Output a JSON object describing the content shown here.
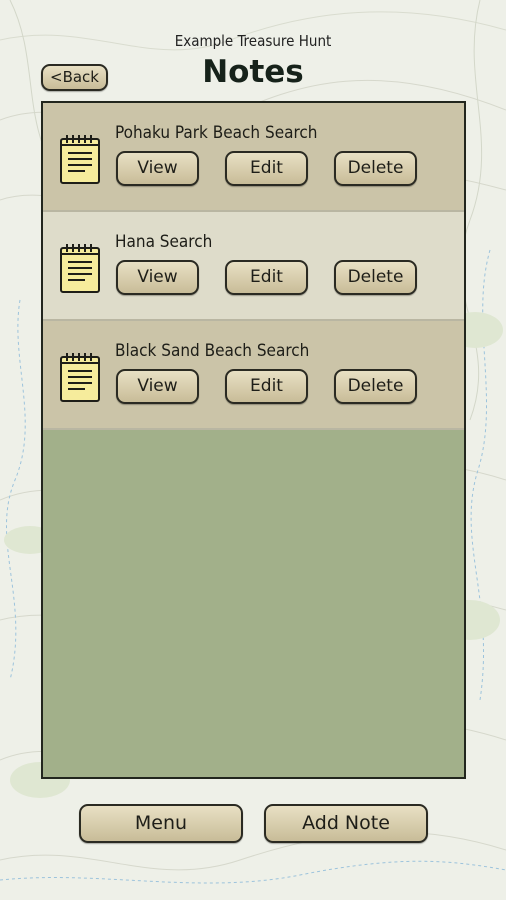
{
  "header": {
    "subtitle": "Example Treasure Hunt",
    "title": "Notes",
    "back_label": "<Back"
  },
  "notes": [
    {
      "title": "Pohaku Park Beach Search",
      "view_label": "View",
      "edit_label": "Edit",
      "delete_label": "Delete"
    },
    {
      "title": "Hana Search",
      "view_label": "View",
      "edit_label": "Edit",
      "delete_label": "Delete"
    },
    {
      "title": "Black Sand Beach Search",
      "view_label": "View",
      "edit_label": "Edit",
      "delete_label": "Delete"
    }
  ],
  "footer": {
    "menu_label": "Menu",
    "add_note_label": "Add Note"
  },
  "icons": {
    "note": "notepad-icon"
  },
  "colors": {
    "list_background": "#a2b08a",
    "row_dark": "#cbc4a8",
    "row_light": "#dedcca",
    "button": "#d8cfae",
    "notepad": "#f6ec9c"
  }
}
